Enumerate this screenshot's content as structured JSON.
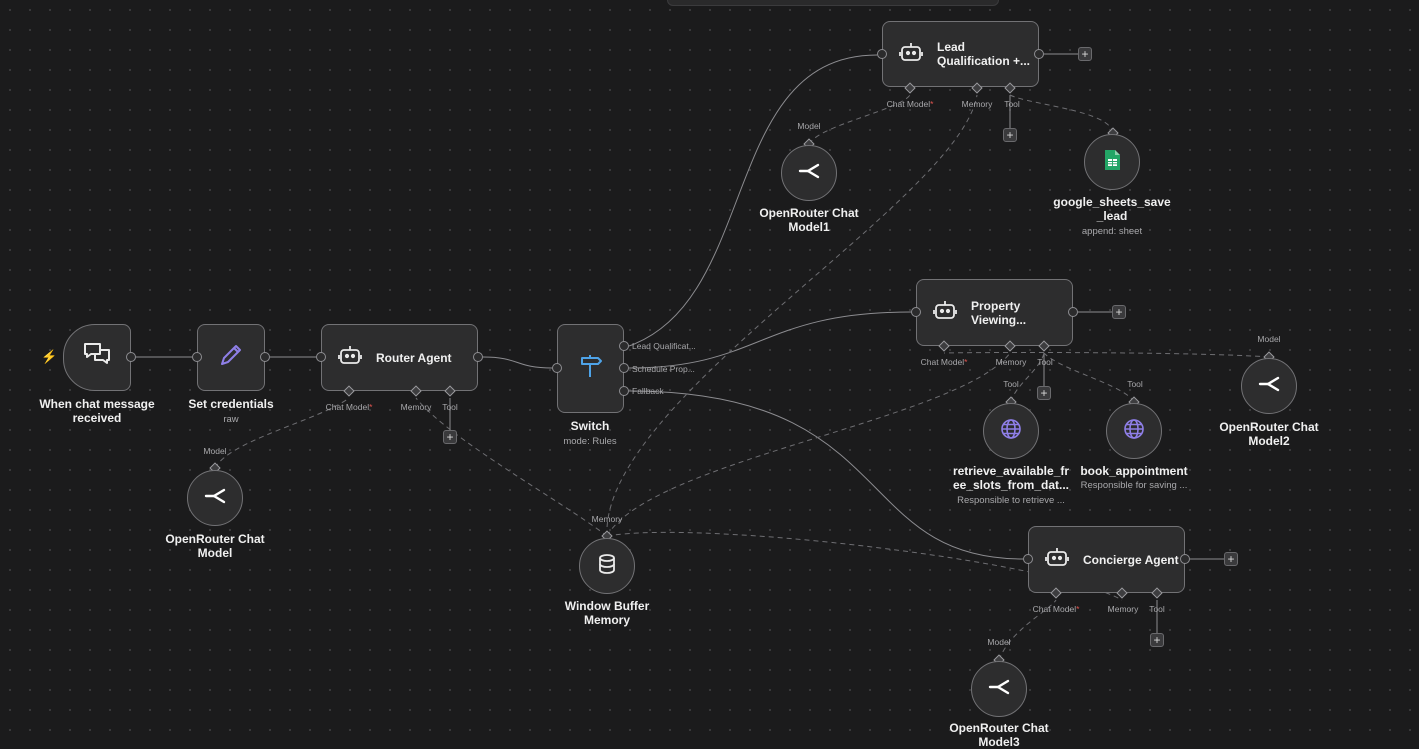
{
  "colors": {
    "canvas": "#1b1b1c",
    "node_fill": "#2d2d2e",
    "node_border": "#727275",
    "edge": "#8c8c90",
    "required": "#e0544f",
    "pencil": "#8f7fe8",
    "switch": "#4ea3e8",
    "globe": "#8f7fe8",
    "sheets": "#23a566"
  },
  "trigger": {
    "title": "When chat message received",
    "icon": "chat-bubbles-icon"
  },
  "set_credentials": {
    "title": "Set credentials",
    "subtitle": "raw",
    "icon": "pencil-icon"
  },
  "router_agent": {
    "title": "Router Agent",
    "icon": "robot-icon",
    "ports": {
      "chat_model": "Chat Model",
      "memory": "Memory",
      "tool": "Tool"
    }
  },
  "switch": {
    "title": "Switch",
    "subtitle": "mode: Rules",
    "icon": "signpost-icon",
    "outputs": [
      "Lead Qualificat...",
      "Schedule Prop...",
      "Fallback"
    ]
  },
  "lead_agent": {
    "title_line1": "Lead",
    "title_line2": "Qualification +...",
    "icon": "robot-icon",
    "ports": {
      "chat_model": "Chat Model",
      "memory": "Memory",
      "tool": "Tool"
    }
  },
  "property_agent": {
    "title_line1": "Property",
    "title_line2": "Viewing...",
    "icon": "robot-icon",
    "ports": {
      "chat_model": "Chat Model",
      "memory": "Memory",
      "tool": "Tool"
    }
  },
  "concierge_agent": {
    "title": "Concierge Agent",
    "icon": "robot-icon",
    "ports": {
      "chat_model": "Chat Model",
      "memory": "Memory",
      "tool": "Tool"
    }
  },
  "openrouter0": {
    "line1": "OpenRouter Chat",
    "line2": "Model",
    "port": "Model",
    "icon": "openrouter-icon"
  },
  "openrouter1": {
    "line1": "OpenRouter Chat",
    "line2": "Model1",
    "port": "Model",
    "icon": "openrouter-icon"
  },
  "openrouter2": {
    "line1": "OpenRouter Chat",
    "line2": "Model2",
    "port": "Model",
    "icon": "openrouter-icon"
  },
  "openrouter3": {
    "line1": "OpenRouter Chat",
    "line2": "Model3",
    "port": "Model",
    "icon": "openrouter-icon"
  },
  "memory_node": {
    "line1": "Window Buffer",
    "line2": "Memory",
    "port": "Memory",
    "icon": "database-icon"
  },
  "google_sheets": {
    "line1": "google_sheets_save",
    "line2": "_lead",
    "subtitle": "append: sheet",
    "icon": "google-sheets-icon"
  },
  "retrieve_tool": {
    "line1": "retrieve_available_fr",
    "line2": "ee_slots_from_dat...",
    "subtitle": "Responsible to retrieve ...",
    "port": "Tool",
    "icon": "globe-icon"
  },
  "book_tool": {
    "line1": "book_appointment",
    "subtitle": "Responsible for saving ...",
    "port": "Tool",
    "icon": "globe-icon"
  },
  "add_symbol": "+",
  "required_mark": "*"
}
